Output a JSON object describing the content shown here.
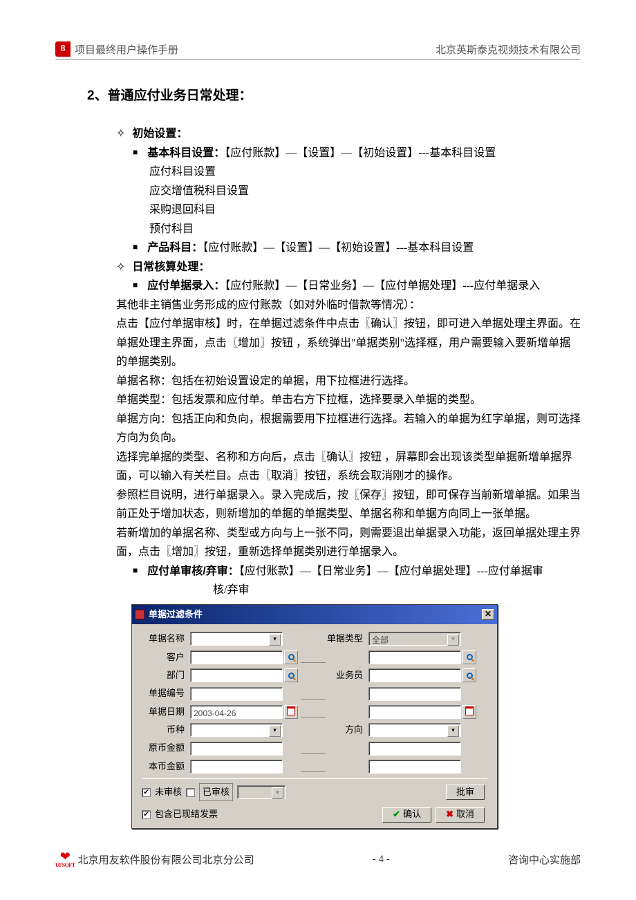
{
  "header": {
    "doc_title": "项目最终用户操作手册",
    "company": "北京英斯泰克视频技术有限公司"
  },
  "section": {
    "number": "2、",
    "title": "普通应付业务日常处理："
  },
  "blocks": {
    "init_label": "初始设置：",
    "basic_subject_label": "基本科目设置：",
    "basic_subject_path": "【应付账款】—【设置】—【初始设置】---基本科目设置",
    "sub_items": [
      "应付科目设置",
      "应交增值税科目设置",
      "采购退回科目",
      "预付科目"
    ],
    "product_subject_label": "产品科目：",
    "product_subject_path": "【应付账款】—【设置】—【初始设置】---基本科目设置",
    "daily_label": "日常核算处理：",
    "ap_entry_label": "应付单据录入：",
    "ap_entry_path": "【应付账款】—【日常业务】—【应付单据处理】---应付单据录入",
    "body": [
      "其他非主销售业务形成的应付账款（如对外临时借款等情况）：",
      "点击【应付单据审核】时，在单据过滤条件中点击〖确认〗按钮，即可进入单据处理主界面。在单据处理主界面，点击〖增加〗按钮 ，系统弹出\"单据类别\"选择框，用户需要输入要新增单据的单据类别。",
      "单据名称：包括在初始设置设定的单据，用下拉框进行选择。",
      "单据类型：包括发票和应付单。单击右方下拉框，选择要录入单据的类型。",
      "单据方向：包括正向和负向，根据需要用下拉框进行选择。若输入的单据为红字单据，则可选择方向为负向。",
      "选择完单据的类型、名称和方向后，点击〖确认〗按钮 ，屏幕即会出现该类型单据新增单据界面，可以输入有关栏目。点击〖取消〗按钮，系统会取消刚才的操作。",
      "参照栏目说明，进行单据录入。录入完成后，按〖保存〗按钮，即可保存当前新增单据。如果当前正处于增加状态，则新增加的单据的单据类型、单据名称和单据方向同上一张单据。",
      "若新增加的单据名称、类型或方向与上一张不同，则需要退出单据录入功能，返回单据处理主界面，点击〖增加〗按钮，重新选择单据类别进行单据录入。"
    ],
    "ap_audit_label": "应付单审核/弃审：",
    "ap_audit_path": "【应付账款】—【日常业务】—【应付单据处理】---应付单据审",
    "ap_audit_cont": "核/弃审"
  },
  "dialog": {
    "title": "单据过滤条件",
    "labels": {
      "doc_name": "单据名称",
      "doc_type": "单据类型",
      "customer": "客户",
      "dept": "部门",
      "salesman": "业务员",
      "doc_no": "单据编号",
      "doc_date": "单据日期",
      "currency": "币种",
      "direction": "方向",
      "orig_amt": "原币金额",
      "local_amt": "本币金额"
    },
    "values": {
      "doc_type": "全部",
      "doc_date": "2003-04-26"
    },
    "checks": {
      "unaudited": "未审核",
      "audited": "已审核",
      "include_settled": "包含已现结发票"
    },
    "buttons": {
      "batch": "批审",
      "ok": "确认",
      "cancel": "取消"
    }
  },
  "footer": {
    "left": "北京用友软件股份有限公司北京分公司",
    "page": "- 4 -",
    "right": "咨询中心实施部",
    "brand": "UFSOFT"
  }
}
